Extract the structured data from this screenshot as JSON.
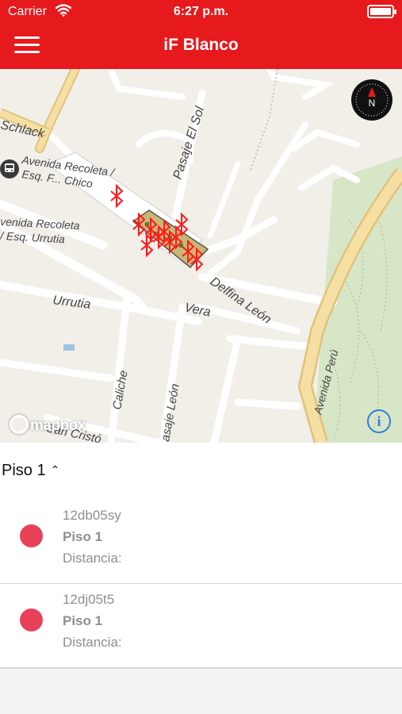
{
  "status_bar": {
    "carrier": "Carrier",
    "time": "6:27 p.m.",
    "battery_level": 1.0
  },
  "header": {
    "title": "iF Blanco",
    "menu_icon": "hamburger-icon"
  },
  "map": {
    "labels": {
      "schlack": "Schlack",
      "bus_stop_line1": "Avenida Recoleta /",
      "bus_stop_line2": "Esq. F... Chico",
      "recoleta_urrutia_line1": "venida Recoleta",
      "recoleta_urrutia_line2": "/ Esq. Urrutia",
      "pasaje_el_sol": "Pasaje El Sol",
      "delfina_leon": "Delfina León",
      "urrutia": "Urrutia",
      "vera": "Vera",
      "avenida_peru": "Avenida Perú",
      "caliche": "Caliche",
      "pasaje_leon": "asaje León",
      "san_cristobal": "San Cristó"
    },
    "attribution": "mapbox",
    "compass_letter": "N",
    "info_label": "i",
    "beacon_icon": "bluetooth-icon",
    "beacon_color": "#ff1a1a",
    "bus_icon": "bus-stop-icon"
  },
  "floor_selector": {
    "value": "Piso 1",
    "icon": "chevron-up-down-icon"
  },
  "devices": [
    {
      "id": "12db05sy",
      "floor": "Piso 1",
      "distance_label": "Distancia:",
      "status_color": "#e9405a"
    },
    {
      "id": "12dj05t5",
      "floor": "Piso 1",
      "distance_label": "Distancia:",
      "status_color": "#e9405a"
    }
  ]
}
